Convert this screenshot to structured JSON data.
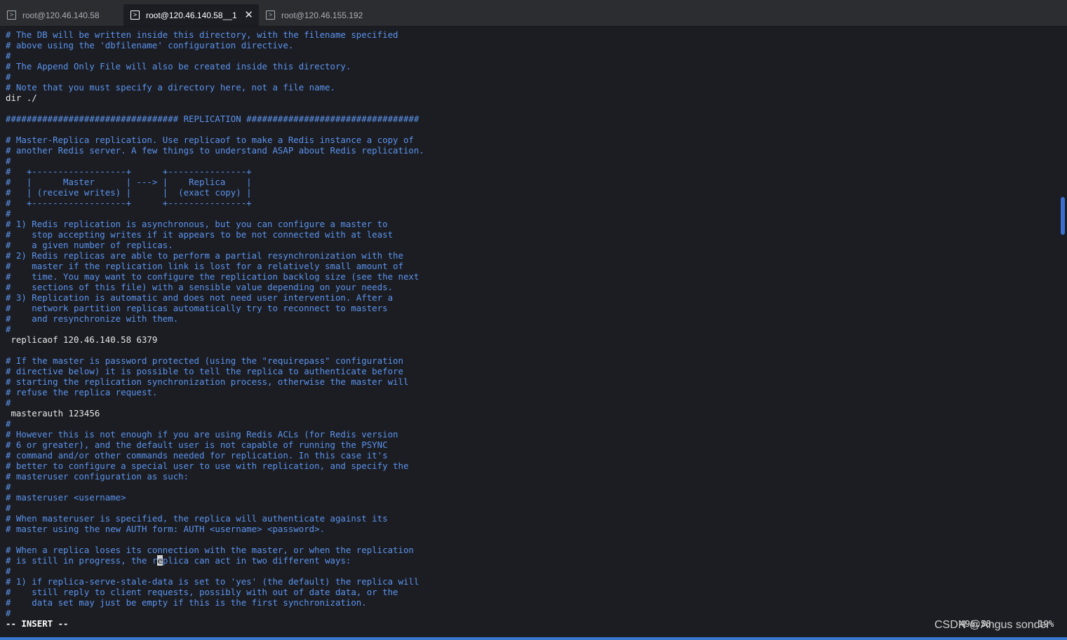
{
  "tabs": [
    {
      "label": "root@120.46.140.58"
    },
    {
      "label": "root@120.46.140.58__1"
    },
    {
      "label": "root@120.46.155.192"
    }
  ],
  "tab_icon": "terminal-icon",
  "close_symbol": "✕",
  "cursor_line": "# is still in progress, the replica can act in two different ways:",
  "cursor_before": "# is still in progress, the r",
  "cursor_char": "e",
  "cursor_after": "plica can act in two different ways:",
  "lines": [
    "# The DB will be written inside this directory, with the filename specified",
    "# above using the 'dbfilename' configuration directive.",
    "#",
    "# The Append Only File will also be created inside this directory.",
    "#",
    "# Note that you must specify a directory here, not a file name.",
    "dir ./",
    "",
    "################################# REPLICATION #################################",
    "",
    "# Master-Replica replication. Use replicaof to make a Redis instance a copy of",
    "# another Redis server. A few things to understand ASAP about Redis replication.",
    "#",
    "#   +------------------+      +---------------+",
    "#   |      Master      | ---> |    Replica    |",
    "#   | (receive writes) |      |  (exact copy) |",
    "#   +------------------+      +---------------+",
    "#",
    "# 1) Redis replication is asynchronous, but you can configure a master to",
    "#    stop accepting writes if it appears to be not connected with at least",
    "#    a given number of replicas.",
    "# 2) Redis replicas are able to perform a partial resynchronization with the",
    "#    master if the replication link is lost for a relatively small amount of",
    "#    time. You may want to configure the replication backlog size (see the next",
    "#    sections of this file) with a sensible value depending on your needs.",
    "# 3) Replication is automatic and does not need user intervention. After a",
    "#    network partition replicas automatically try to reconnect to masters",
    "#    and resynchronize with them.",
    "#",
    " replicaof 120.46.140.58 6379",
    "",
    "# If the master is password protected (using the \"requirepass\" configuration",
    "# directive below) it is possible to tell the replica to authenticate before",
    "# starting the replication synchronization process, otherwise the master will",
    "# refuse the replica request.",
    "#",
    " masterauth 123456",
    "#",
    "# However this is not enough if you are using Redis ACLs (for Redis version",
    "# 6 or greater), and the default user is not capable of running the PSYNC",
    "# command and/or other commands needed for replication. In this case it's",
    "# better to configure a special user to use with replication, and specify the",
    "# masteruser configuration as such:",
    "#",
    "# masteruser <username>",
    "#",
    "# When masteruser is specified, the replica will authenticate against its",
    "# master using the new AUTH form: AUTH <username> <password>.",
    "",
    "# When a replica loses its connection with the master, or when the replication",
    "# is still in progress, the replica can act in two different ways:",
    "#",
    "# 1) if replica-serve-stale-data is set to 'yes' (the default) the replica will",
    "#    still reply to client requests, possibly with out of date data, or the",
    "#    data set may just be empty if this is the first synchronization.",
    "#"
  ],
  "status": {
    "mode": "-- INSERT --",
    "position": "496,58",
    "percent": "19%"
  },
  "watermark": "CSDN @Angus sonder",
  "colors": {
    "background": "#1b1d23",
    "comment": "#5c93ec",
    "text": "#e8e8e8",
    "accent": "#3a78cf"
  }
}
